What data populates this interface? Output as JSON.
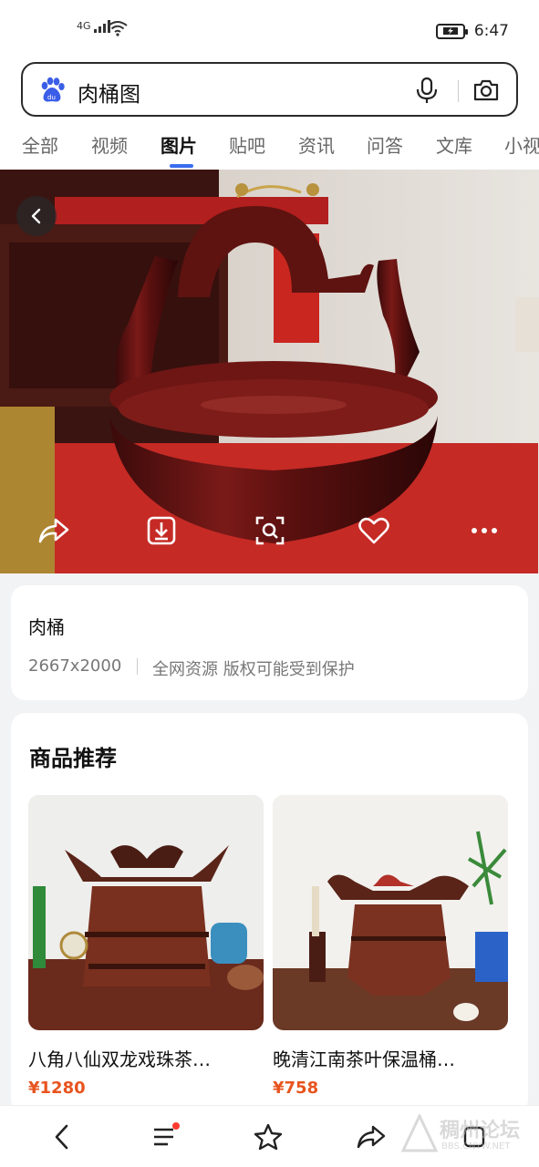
{
  "status_bar": {
    "network": "4G",
    "time": "6:47"
  },
  "search": {
    "query": "肉桶图"
  },
  "tabs": [
    {
      "label": "全部"
    },
    {
      "label": "视频"
    },
    {
      "label": "图片"
    },
    {
      "label": "贴吧"
    },
    {
      "label": "资讯"
    },
    {
      "label": "问答"
    },
    {
      "label": "文库"
    },
    {
      "label": "小视"
    }
  ],
  "image_info": {
    "title": "肉桶",
    "dimensions": "2667x2000",
    "source": "全网资源 版权可能受到保护"
  },
  "products": {
    "section_title": "商品推荐",
    "items": [
      {
        "name": "八角八仙双龙戏珠茶…",
        "price": "¥1280"
      },
      {
        "name": "晚清江南茶叶保温桶…",
        "price": "¥758"
      }
    ]
  },
  "watermark": {
    "text": "稠州论坛",
    "sub": "BBS.CNYW.NET"
  },
  "colors": {
    "accent": "#3a6df0",
    "price": "#e8541e"
  }
}
